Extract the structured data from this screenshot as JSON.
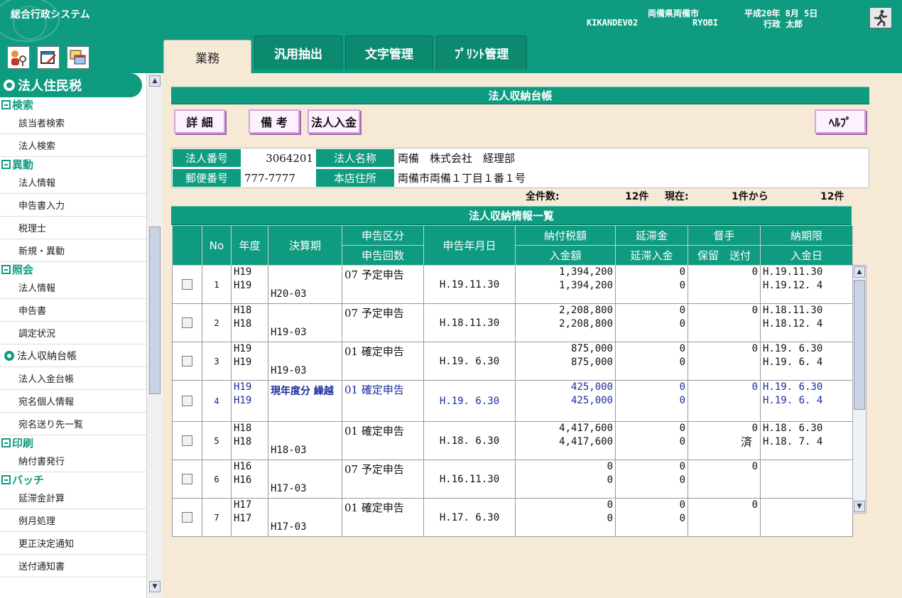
{
  "header": {
    "system_name": "総合行政システム",
    "municipality": "両備県両備市",
    "date": "平成20年  8月  5日",
    "terminal": "KIKANDEV02",
    "server": "RYOBI",
    "user": "行政  太郎",
    "exit_icon": "running-man-exit-icon",
    "toolbar_icons": [
      "user-key-icon",
      "edit-document-icon",
      "window-switch-icon"
    ]
  },
  "tabs": [
    {
      "label": "業務",
      "active": true
    },
    {
      "label": "汎用抽出",
      "active": false
    },
    {
      "label": "文字管理",
      "active": false
    },
    {
      "label": "ﾌﾟﾘﾝﾄ管理",
      "active": false
    }
  ],
  "sidebar": {
    "title": "法人住民税",
    "groups": [
      {
        "label": "検索",
        "items": [
          {
            "label": "該当者検索"
          },
          {
            "label": "法人検索"
          }
        ]
      },
      {
        "label": "異動",
        "items": [
          {
            "label": "法人情報"
          },
          {
            "label": "申告書入力"
          },
          {
            "label": "税理士"
          },
          {
            "label": "新規・異動"
          }
        ]
      },
      {
        "label": "照会",
        "items": [
          {
            "label": "法人情報"
          },
          {
            "label": "申告書"
          },
          {
            "label": "調定状況"
          },
          {
            "label": "法人収納台帳",
            "current": true
          },
          {
            "label": "法人入金台帳"
          },
          {
            "label": "宛名個人情報"
          },
          {
            "label": "宛名送り先一覧"
          }
        ]
      },
      {
        "label": "印刷",
        "items": [
          {
            "label": "納付書発行"
          }
        ]
      },
      {
        "label": "バッチ",
        "items": [
          {
            "label": "延滞金計算"
          },
          {
            "label": "例月処理"
          },
          {
            "label": "更正決定通知"
          },
          {
            "label": "送付通知書"
          }
        ]
      }
    ]
  },
  "main": {
    "title": "法人収納台帳",
    "buttons": {
      "detail": "詳 細",
      "remarks": "備 考",
      "payment": "法人入金",
      "help": "ﾍﾙﾌﾟ"
    },
    "corp": {
      "number_label": "法人番号",
      "number": "3064201",
      "name_label": "法人名称",
      "name": "両備　株式会社　経理部",
      "postal_label": "郵便番号",
      "postal": "777-7777",
      "address_label": "本店住所",
      "address": "両備市両備１丁目１番１号"
    },
    "count": {
      "total_label": "全件数:",
      "total": "12件",
      "current_label": "現在:",
      "from": "1件から",
      "to": "12件"
    },
    "list_title": "法人収納情報一覧",
    "columns": {
      "no": "No",
      "year": "年度",
      "period": "決算期",
      "kubun": "申告区分",
      "kaisu": "申告回数",
      "date": "申告年月日",
      "tax": "納付税額",
      "paid": "入金額",
      "late": "延滞金",
      "late_paid": "延滞入金",
      "tokusoku": "督手",
      "hold_send": "保留　送付",
      "due": "納期限",
      "paid_date": "入金日"
    },
    "rows": [
      {
        "no": "1",
        "year1": "H19",
        "year2": "H19",
        "period": "H20-03",
        "shinkoku": "07 予定申告",
        "date": "H.19.11.30",
        "tax": "1,394,200",
        "paid": "1,394,200",
        "late": "0",
        "late_paid": "0",
        "tokusoku": "0",
        "sent": "",
        "due": "H.19.11.30",
        "paid_date": "H.19.12. 4"
      },
      {
        "no": "2",
        "year1": "H18",
        "year2": "H18",
        "period": "H19-03",
        "shinkoku": "07 予定申告",
        "date": "H.18.11.30",
        "tax": "2,208,800",
        "paid": "2,208,800",
        "late": "0",
        "late_paid": "0",
        "tokusoku": "0",
        "sent": "",
        "due": "H.18.11.30",
        "paid_date": "H.18.12. 4"
      },
      {
        "no": "3",
        "year1": "H19",
        "year2": "H19",
        "period": "H19-03",
        "shinkoku": "01 確定申告",
        "date": "H.19. 6.30",
        "tax": "875,000",
        "paid": "875,000",
        "late": "0",
        "late_paid": "0",
        "tokusoku": "0",
        "sent": "",
        "due": "H.19. 6.30",
        "paid_date": "H.19. 6. 4"
      },
      {
        "no": "4",
        "year1": "H19",
        "year2": "H19",
        "period": "現年度分 繰越",
        "shinkoku": "01 確定申告",
        "date": "H.19. 6.30",
        "tax": "425,000",
        "paid": "425,000",
        "late": "0",
        "late_paid": "0",
        "tokusoku": "0",
        "sent": "",
        "due": "H.19. 6.30",
        "paid_date": "H.19. 6. 4",
        "highlight": true
      },
      {
        "no": "5",
        "year1": "H18",
        "year2": "H18",
        "period": "H18-03",
        "shinkoku": "01 確定申告",
        "date": "H.18. 6.30",
        "tax": "4,417,600",
        "paid": "4,417,600",
        "late": "0",
        "late_paid": "0",
        "tokusoku": "0",
        "sent": "済",
        "due": "H.18. 6.30",
        "paid_date": "H.18. 7. 4"
      },
      {
        "no": "6",
        "year1": "H16",
        "year2": "H16",
        "period": "H17-03",
        "shinkoku": "07 予定申告",
        "date": "H.16.11.30",
        "tax": "0",
        "paid": "0",
        "late": "0",
        "late_paid": "0",
        "tokusoku": "0",
        "sent": "",
        "due": "",
        "paid_date": ""
      },
      {
        "no": "7",
        "year1": "H17",
        "year2": "H17",
        "period": "H17-03",
        "shinkoku": "01 確定申告",
        "date": "H.17. 6.30",
        "tax": "0",
        "paid": "0",
        "late": "0",
        "late_paid": "0",
        "tokusoku": "0",
        "sent": "",
        "due": "",
        "paid_date": ""
      }
    ]
  }
}
